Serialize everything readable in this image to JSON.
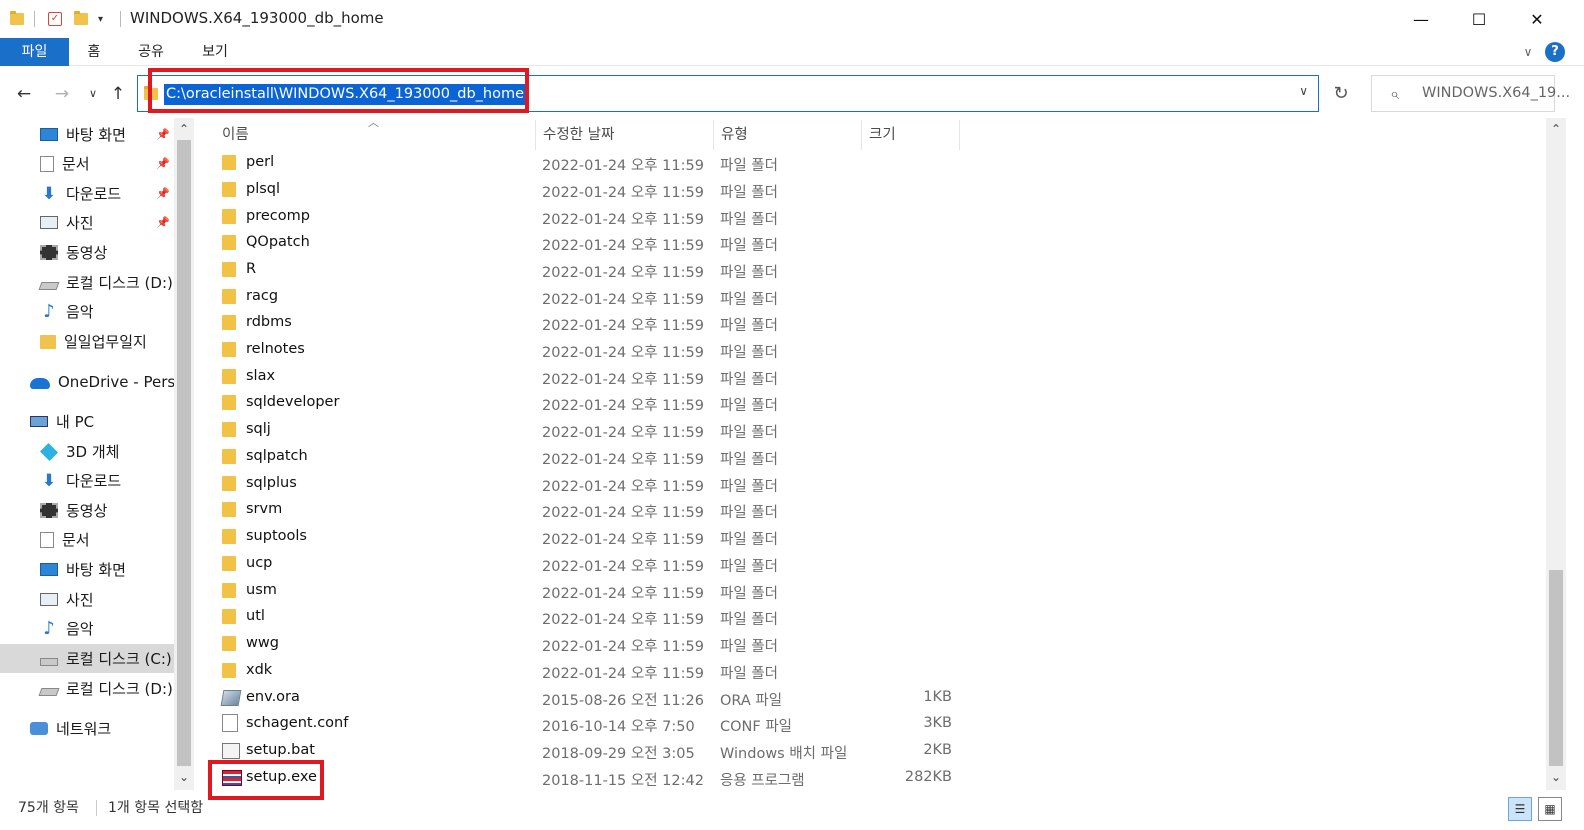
{
  "window": {
    "title": "WINDOWS.X64_193000_db_home",
    "minimize": "—",
    "maximize": "☐",
    "close": "✕"
  },
  "ribbon": {
    "tabs": [
      "파일",
      "홈",
      "공유",
      "보기"
    ],
    "expand": "∨",
    "help": "?"
  },
  "address": {
    "back": "←",
    "forward": "→",
    "recent": "∨",
    "up": "↑",
    "path": "C:\\oracleinstall\\WINDOWS.X64_193000_db_home",
    "dropdown": "∨",
    "refresh": "↻",
    "search_placeholder": "WINDOWS.X64_19..."
  },
  "sidebar": {
    "items": [
      {
        "label": "바탕 화면",
        "icon": "desktop-icon",
        "pinned": true
      },
      {
        "label": "문서",
        "icon": "documents-icon",
        "pinned": true
      },
      {
        "label": "다운로드",
        "icon": "download-icon",
        "pinned": true
      },
      {
        "label": "사진",
        "icon": "pictures-icon",
        "pinned": true
      },
      {
        "label": "동영상",
        "icon": "video-icon",
        "pinned": false
      },
      {
        "label": "로컬 디스크 (D:)",
        "icon": "drive-icon",
        "pinned": false
      },
      {
        "label": "음악",
        "icon": "music-icon",
        "pinned": false
      },
      {
        "label": "일일업무일지",
        "icon": "folder-icon",
        "pinned": false
      },
      {
        "label": "OneDrive - Personal",
        "icon": "onedrive-icon",
        "pinned": false
      },
      {
        "label": "내 PC",
        "icon": "pc-icon",
        "pinned": false
      },
      {
        "label": "3D 개체",
        "icon": "3d-objects-icon",
        "pinned": false
      },
      {
        "label": "다운로드",
        "icon": "download-icon",
        "pinned": false
      },
      {
        "label": "동영상",
        "icon": "video-icon",
        "pinned": false
      },
      {
        "label": "문서",
        "icon": "documents-icon",
        "pinned": false
      },
      {
        "label": "바탕 화면",
        "icon": "desktop-icon",
        "pinned": false
      },
      {
        "label": "사진",
        "icon": "pictures-icon",
        "pinned": false
      },
      {
        "label": "음악",
        "icon": "music-icon",
        "pinned": false
      },
      {
        "label": "로컬 디스크 (C:)",
        "icon": "system-drive-icon",
        "pinned": false,
        "selected": true
      },
      {
        "label": "로컬 디스크 (D:)",
        "icon": "drive-icon",
        "pinned": false
      },
      {
        "label": "네트워크",
        "icon": "network-icon",
        "pinned": false
      }
    ]
  },
  "columns": {
    "name": "이름",
    "modified": "수정한 날짜",
    "type": "유형",
    "size": "크기"
  },
  "files": [
    {
      "name": "perl",
      "date": "2022-01-24 오후 11:59",
      "type": "파일 폴더",
      "size": "",
      "icon": "folder-icon"
    },
    {
      "name": "plsql",
      "date": "2022-01-24 오후 11:59",
      "type": "파일 폴더",
      "size": "",
      "icon": "folder-icon"
    },
    {
      "name": "precomp",
      "date": "2022-01-24 오후 11:59",
      "type": "파일 폴더",
      "size": "",
      "icon": "folder-icon"
    },
    {
      "name": "QOpatch",
      "date": "2022-01-24 오후 11:59",
      "type": "파일 폴더",
      "size": "",
      "icon": "folder-icon"
    },
    {
      "name": "R",
      "date": "2022-01-24 오후 11:59",
      "type": "파일 폴더",
      "size": "",
      "icon": "folder-icon"
    },
    {
      "name": "racg",
      "date": "2022-01-24 오후 11:59",
      "type": "파일 폴더",
      "size": "",
      "icon": "folder-icon"
    },
    {
      "name": "rdbms",
      "date": "2022-01-24 오후 11:59",
      "type": "파일 폴더",
      "size": "",
      "icon": "folder-icon"
    },
    {
      "name": "relnotes",
      "date": "2022-01-24 오후 11:59",
      "type": "파일 폴더",
      "size": "",
      "icon": "folder-icon"
    },
    {
      "name": "slax",
      "date": "2022-01-24 오후 11:59",
      "type": "파일 폴더",
      "size": "",
      "icon": "folder-icon"
    },
    {
      "name": "sqldeveloper",
      "date": "2022-01-24 오후 11:59",
      "type": "파일 폴더",
      "size": "",
      "icon": "folder-icon"
    },
    {
      "name": "sqlj",
      "date": "2022-01-24 오후 11:59",
      "type": "파일 폴더",
      "size": "",
      "icon": "folder-icon"
    },
    {
      "name": "sqlpatch",
      "date": "2022-01-24 오후 11:59",
      "type": "파일 폴더",
      "size": "",
      "icon": "folder-icon"
    },
    {
      "name": "sqlplus",
      "date": "2022-01-24 오후 11:59",
      "type": "파일 폴더",
      "size": "",
      "icon": "folder-icon"
    },
    {
      "name": "srvm",
      "date": "2022-01-24 오후 11:59",
      "type": "파일 폴더",
      "size": "",
      "icon": "folder-icon"
    },
    {
      "name": "suptools",
      "date": "2022-01-24 오후 11:59",
      "type": "파일 폴더",
      "size": "",
      "icon": "folder-icon"
    },
    {
      "name": "ucp",
      "date": "2022-01-24 오후 11:59",
      "type": "파일 폴더",
      "size": "",
      "icon": "folder-icon"
    },
    {
      "name": "usm",
      "date": "2022-01-24 오후 11:59",
      "type": "파일 폴더",
      "size": "",
      "icon": "folder-icon"
    },
    {
      "name": "utl",
      "date": "2022-01-24 오후 11:59",
      "type": "파일 폴더",
      "size": "",
      "icon": "folder-icon"
    },
    {
      "name": "wwg",
      "date": "2022-01-24 오후 11:59",
      "type": "파일 폴더",
      "size": "",
      "icon": "folder-icon"
    },
    {
      "name": "xdk",
      "date": "2022-01-24 오후 11:59",
      "type": "파일 폴더",
      "size": "",
      "icon": "folder-icon"
    },
    {
      "name": "env.ora",
      "date": "2015-08-26 오전 11:26",
      "type": "ORA 파일",
      "size": "1KB",
      "icon": "ora-file-icon"
    },
    {
      "name": "schagent.conf",
      "date": "2016-10-14 오후 7:50",
      "type": "CONF 파일",
      "size": "3KB",
      "icon": "file-icon"
    },
    {
      "name": "setup.bat",
      "date": "2018-09-29 오전 3:05",
      "type": "Windows 배치 파일",
      "size": "2KB",
      "icon": "batch-file-icon"
    },
    {
      "name": "setup.exe",
      "date": "2018-11-15 오전 12:42",
      "type": "응용 프로그램",
      "size": "282KB",
      "icon": "exe-file-icon"
    }
  ],
  "status": {
    "item_count": "75개 항목",
    "selected": "1개 항목 선택함"
  },
  "colors": {
    "accent": "#1a6fc9",
    "highlight_box": "#e11820",
    "selection": "#0a64d6"
  }
}
